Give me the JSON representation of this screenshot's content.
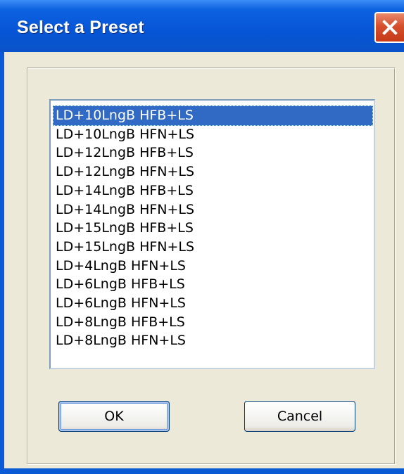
{
  "window": {
    "title": "Select a Preset",
    "close_icon": "close-icon"
  },
  "presets": {
    "items": [
      "LD+10LngB HFB+LS",
      "LD+10LngB HFN+LS",
      "LD+12LngB HFB+LS",
      "LD+12LngB HFN+LS",
      "LD+14LngB HFB+LS",
      "LD+14LngB HFN+LS",
      "LD+15LngB HFB+LS",
      "LD+15LngB HFN+LS",
      "LD+4LngB HFN+LS",
      "LD+6LngB HFB+LS",
      "LD+6LngB HFN+LS",
      "LD+8LngB HFB+LS",
      "LD+8LngB HFN+LS"
    ],
    "selected_index": 0
  },
  "buttons": {
    "ok_label": "OK",
    "cancel_label": "Cancel"
  },
  "colors": {
    "titlebar": "#0655d6",
    "selection": "#316ac5",
    "dialog_face": "#ece9d8",
    "close_button": "#d6502c"
  }
}
